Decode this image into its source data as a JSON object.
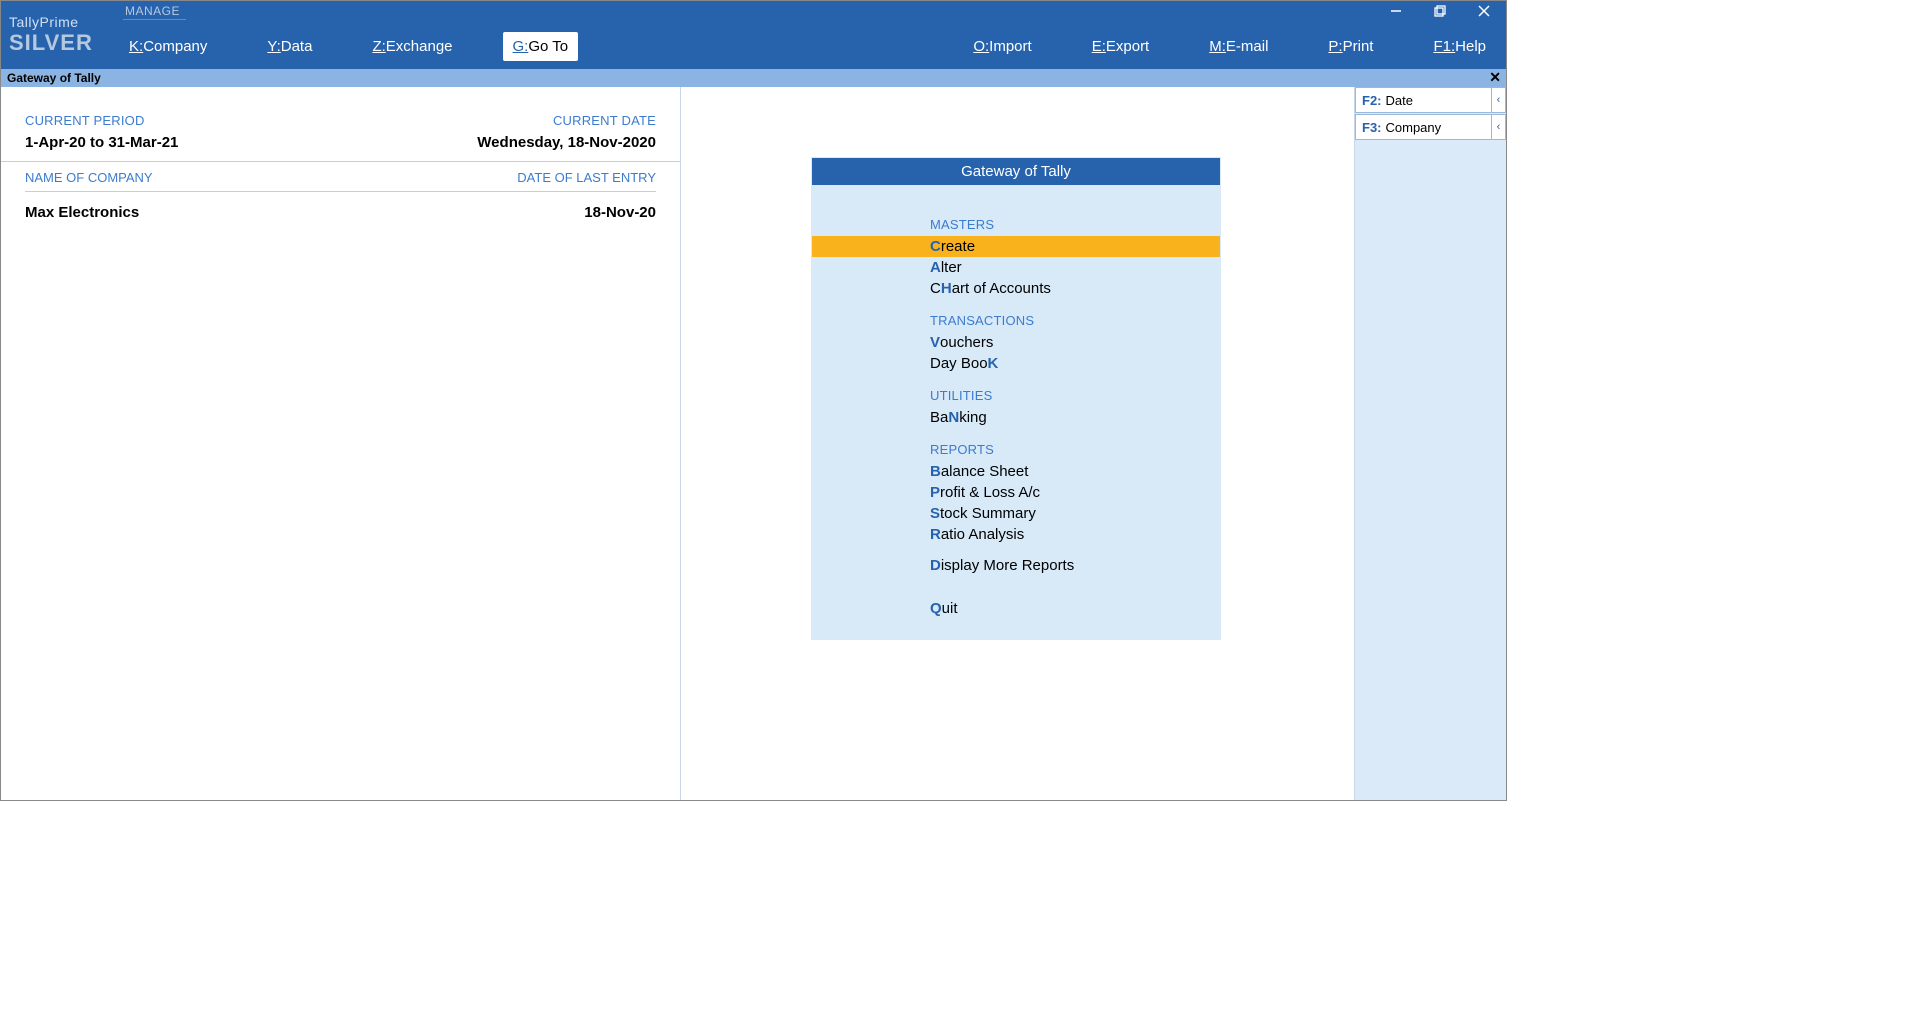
{
  "brand": {
    "line1": "TallyPrime",
    "line2": "SILVER"
  },
  "manage_label": "MANAGE",
  "menu": {
    "company": {
      "key": "K:",
      "label": "Company"
    },
    "data": {
      "key": "Y:",
      "label": "Data"
    },
    "exchange": {
      "key": "Z:",
      "label": "Exchange"
    },
    "goto": {
      "key": "G:",
      "label": "Go To"
    },
    "import": {
      "key": "O:",
      "label": "Import"
    },
    "export": {
      "key": "E:",
      "label": "Export"
    },
    "email": {
      "key": "M:",
      "label": "E-mail"
    },
    "print": {
      "key": "P:",
      "label": "Print"
    },
    "help": {
      "key": "F1:",
      "label": "Help"
    }
  },
  "subheader": "Gateway of Tally",
  "period": {
    "label_period": "CURRENT PERIOD",
    "label_date": "CURRENT DATE",
    "value_period": "1-Apr-20 to 31-Mar-21",
    "value_date": "Wednesday, 18-Nov-2020"
  },
  "company_header": {
    "name_label": "NAME OF COMPANY",
    "date_label": "DATE OF LAST ENTRY"
  },
  "company": {
    "name": "Max Electronics",
    "last_entry": "18-Nov-20"
  },
  "gateway": {
    "title": "Gateway of Tally",
    "sections": {
      "masters": "MASTERS",
      "transactions": "TRANSACTIONS",
      "utilities": "UTILITIES",
      "reports": "REPORTS"
    },
    "items": {
      "create": {
        "pre": "",
        "hk": "C",
        "post": "reate"
      },
      "alter": {
        "pre": "",
        "hk": "A",
        "post": "lter"
      },
      "chart": {
        "pre": "C",
        "hk": "H",
        "post": "art of Accounts"
      },
      "vouchers": {
        "pre": "",
        "hk": "V",
        "post": "ouchers"
      },
      "daybook": {
        "pre": "Day Boo",
        "hk": "K",
        "post": ""
      },
      "banking": {
        "pre": "Ba",
        "hk": "N",
        "post": "king"
      },
      "balsheet": {
        "pre": "",
        "hk": "B",
        "post": "alance Sheet"
      },
      "pl": {
        "pre": "",
        "hk": "P",
        "post": "rofit & Loss A/c"
      },
      "stock": {
        "pre": "",
        "hk": "S",
        "post": "tock Summary"
      },
      "ratio": {
        "pre": "",
        "hk": "R",
        "post": "atio Analysis"
      },
      "more": {
        "pre": "",
        "hk": "D",
        "post": "isplay More Reports"
      },
      "quit": {
        "pre": "",
        "hk": "Q",
        "post": "uit"
      }
    }
  },
  "sidebar": {
    "date": {
      "key": "F2:",
      "label": "Date"
    },
    "company": {
      "key": "F3:",
      "label": "Company"
    }
  }
}
